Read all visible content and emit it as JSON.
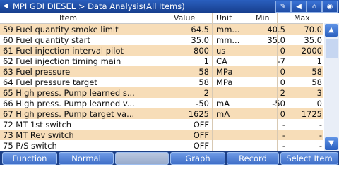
{
  "title": {
    "back_icon": "back-arrow-icon",
    "breadcrumb": "MPI   GDI   DIESEL > Data Analysis(All Items)",
    "tools": [
      "pen-icon",
      "back-icon",
      "home-icon",
      "camera-icon"
    ]
  },
  "columns": {
    "item": "Item",
    "value": "Value",
    "unit": "Unit",
    "min": "Min",
    "max": "Max"
  },
  "rows": [
    {
      "item": "59 Fuel quantity smoke limit",
      "value": "64.5",
      "unit": "mm...",
      "min": "40.5",
      "max": "70.0"
    },
    {
      "item": "60 Fuel quantity start",
      "value": "35.0",
      "unit": "mm...",
      "min": "35.0",
      "max": "35.0"
    },
    {
      "item": "61 Fuel injection interval pilot",
      "value": "800",
      "unit": "us",
      "min": "0",
      "max": "2000"
    },
    {
      "item": "62 Fuel injection timing main",
      "value": "1",
      "unit": "CA",
      "min": "-7",
      "max": "1"
    },
    {
      "item": "63 Fuel pressure",
      "value": "58",
      "unit": "MPa",
      "min": "0",
      "max": "58"
    },
    {
      "item": "64 Fuel pressure target",
      "value": "58",
      "unit": "MPa",
      "min": "0",
      "max": "58"
    },
    {
      "item": "65 High press. Pump learned s...",
      "value": "2",
      "unit": "",
      "min": "2",
      "max": "3"
    },
    {
      "item": "66 High press. Pump learned v...",
      "value": "-50",
      "unit": "mA",
      "min": "-50",
      "max": "0"
    },
    {
      "item": "67 High press. Pump target va...",
      "value": "1625",
      "unit": "mA",
      "min": "0",
      "max": "1725"
    },
    {
      "item": "72 MT 1st switch",
      "value": "OFF",
      "unit": "",
      "min": "-",
      "max": "-"
    },
    {
      "item": "73 MT Rev switch",
      "value": "OFF",
      "unit": "",
      "min": "-",
      "max": "-"
    },
    {
      "item": "75 P/S switch",
      "value": "OFF",
      "unit": "",
      "min": "-",
      "max": "-"
    }
  ],
  "footer": {
    "function": "Function",
    "normal": "Normal",
    "blank": "",
    "graph": "Graph",
    "record": "Record",
    "select_item": "Select Item"
  },
  "colors": {
    "odd_row": "#f7ddb8",
    "title_bar": "#1f4da6",
    "footer": "#1c3f86"
  }
}
